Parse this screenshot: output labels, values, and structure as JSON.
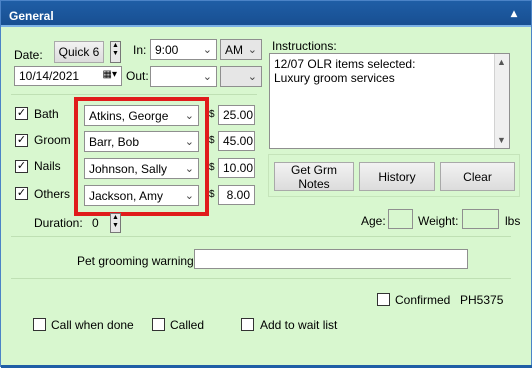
{
  "window": {
    "title": "General"
  },
  "top": {
    "date_label": "Date:",
    "quick_button": "Quick 6",
    "date_value": "10/14/2021",
    "in_label": "In:",
    "in_time": "9:00",
    "in_ampm": "AM",
    "out_label": "Out:",
    "out_time": "",
    "out_ampm": ""
  },
  "instructions": {
    "label": "Instructions:",
    "line1": "12/07 OLR items selected:",
    "line2": "Luxury groom services"
  },
  "services": [
    {
      "label": "Bath",
      "checked": true,
      "staff": "Atkins, George",
      "price": "25.00"
    },
    {
      "label": "Groom",
      "checked": true,
      "staff": "Barr, Bob",
      "price": "45.00"
    },
    {
      "label": "Nails",
      "checked": true,
      "staff": "Johnson, Sally",
      "price": "10.00"
    },
    {
      "label": "Others",
      "checked": true,
      "staff": "Jackson, Amy",
      "price": "8.00"
    }
  ],
  "currency_symbol": "$",
  "buttons": {
    "grm_notes": "Get Grm Notes",
    "history": "History",
    "clear": "Clear"
  },
  "duration": {
    "label": "Duration:",
    "value": "0"
  },
  "age": {
    "label": "Age:",
    "value": ""
  },
  "weight": {
    "label": "Weight:",
    "value": "",
    "unit": "lbs"
  },
  "warning": {
    "label": "Pet grooming warning:",
    "value": ""
  },
  "confirmed": {
    "label": "Confirmed",
    "checked": false,
    "code": "PH5375"
  },
  "bottom_options": [
    {
      "label": "Call when done",
      "checked": false
    },
    {
      "label": "Called",
      "checked": false
    },
    {
      "label": "Add to wait list",
      "checked": false
    }
  ],
  "colors": {
    "panel_bg": "#d8f7cf",
    "title_bg": "#1f5ea6",
    "highlight": "#e01b1b"
  }
}
